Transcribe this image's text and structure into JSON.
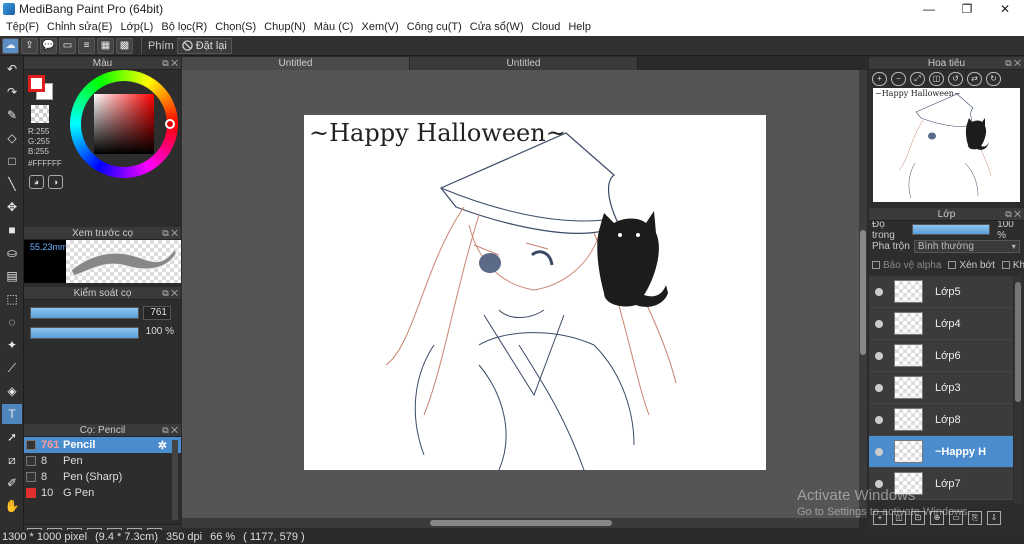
{
  "window": {
    "title": "MediBang Paint Pro (64bit)",
    "minimize": "—",
    "maximize": "❐",
    "close": "✕"
  },
  "menu": [
    "Tệp(F)",
    "Chỉnh sửa(E)",
    "Lớp(L)",
    "Bộ lọc(R)",
    "Chọn(S)",
    "Chụp(N)",
    "Màu (C)",
    "Xem(V)",
    "Công cụ(T)",
    "Cửa sổ(W)",
    "Cloud",
    "Help"
  ],
  "toolbar": {
    "shortcut_label": "Phím",
    "reset_label": "Đặt lại"
  },
  "color_panel": {
    "title": "Màu",
    "r": "R:255",
    "g": "G:255",
    "b": "B:255",
    "hex": "#FFFFFF",
    "foreground": "#ffffff",
    "background_swatch": "#e02020"
  },
  "brush_preview": {
    "title": "Xem trước cọ",
    "size": "55.23mm"
  },
  "brush_control": {
    "title": "Kiểm soát cọ",
    "size_value": "761",
    "opacity_value": "100 %",
    "size_fraction": 1.0,
    "opacity_percent": 100
  },
  "brush_list": {
    "title": "Cọ: Pencil",
    "items": [
      {
        "size": "761",
        "name": "Pencil",
        "color": "#333333"
      },
      {
        "size": "8",
        "name": "Pen",
        "color": "#333333"
      },
      {
        "size": "8",
        "name": "Pen (Sharp)",
        "color": "#333333"
      },
      {
        "size": "10",
        "name": "G Pen",
        "color": "#e03030"
      }
    ]
  },
  "tabs": [
    "Untitled",
    "Untitled"
  ],
  "canvas": {
    "text": "~Happy Halloween~"
  },
  "status": {
    "size": "1300 * 1000 pixel",
    "dims": "(9.4 * 7.3cm)",
    "dpi": "350 dpi",
    "zoom": "66 %",
    "cursor": "( 1177, 579 )"
  },
  "navigator": {
    "title": "Hoa tiêu",
    "preview_text": "~Happy Halloween~"
  },
  "layer_panel": {
    "title": "Lớp",
    "opacity_label": "Độ trong",
    "opacity_value": "100 %",
    "blend_label": "Pha trộn",
    "blend_value": "Bình thường",
    "protect_alpha": "Bảo vệ alpha",
    "clipping": "Xén bớt",
    "lock": "Khóa",
    "layers": [
      {
        "name": "Lớp5"
      },
      {
        "name": "Lớp4"
      },
      {
        "name": "Lớp6"
      },
      {
        "name": "Lớp3"
      },
      {
        "name": "Lớp8"
      },
      {
        "name": "~Happy H"
      },
      {
        "name": "Lớp7"
      }
    ]
  },
  "watermark": {
    "line1": "Activate Windows",
    "line2": "Go to Settings to activate Windows."
  }
}
